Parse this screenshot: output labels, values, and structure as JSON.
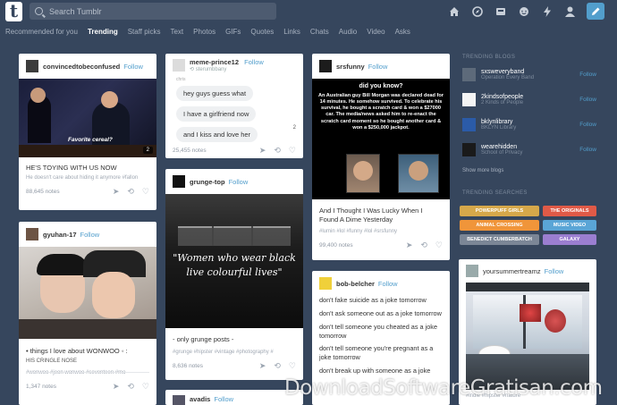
{
  "header": {
    "logo": "t",
    "search_placeholder": "Search Tumblr",
    "compose_icon": "pencil-icon",
    "icons": [
      "home-icon",
      "explore-icon",
      "inbox-icon",
      "messages-icon",
      "activity-icon",
      "account-icon"
    ]
  },
  "nav": {
    "items": [
      "Recommended for you",
      "Trending",
      "Staff picks",
      "Text",
      "Photos",
      "GIFs",
      "Quotes",
      "Links",
      "Chats",
      "Audio",
      "Video",
      "Asks"
    ],
    "active": "Trending"
  },
  "col1": {
    "post1": {
      "user": "convincedtobeconfused",
      "follow": "Follow",
      "gif_caption": "Favorite cereal?",
      "badge": "2",
      "caption": "HE'S TOYING WITH US NOW",
      "sub": "He doesn't care about hiding it anymore",
      "sub_tag": "#fallon",
      "notes": "88,645 notes"
    },
    "post2": {
      "user": "gyuhan-17",
      "follow": "Follow",
      "caption": "• things I love about WONWOO ◦ :",
      "sub": "HIS CRINGLE NOSE",
      "tags": "#wonwoo  #jeon wonwoo  #seventeen  #mo",
      "notes": "1,347 notes",
      "badge": "2"
    }
  },
  "col2": {
    "post1": {
      "user": "meme-prince12",
      "follow": "Follow",
      "via": "sterumbbany",
      "chat_label": "chris",
      "chat": [
        "hey guys guess what",
        "I have a girlfriend now",
        "and I kiss and love her"
      ],
      "badge": "2",
      "notes": "25,455 notes"
    },
    "post2": {
      "user": "grunge-top",
      "follow": "Follow",
      "quote_line1": "\"Women who wear black",
      "quote_line2": "live colourful lives\"",
      "caption": "- only grunge posts -",
      "tags": "#grunge  #hipster  #vintage  #photography  #",
      "notes": "8,636 notes"
    },
    "post3": {
      "user": "avadis",
      "follow": "Follow"
    }
  },
  "col3": {
    "post1": {
      "user": "srsfunny",
      "follow": "Follow",
      "meme_title": "did you know?",
      "meme_text": "An Australian guy Bill Morgan was declared dead for 14 minutes. He somehow survived. To celebrate his survival, he bought a scratch card & won a $27000 car. The media/news asked him to re-enact the scratch card moment so he bought another card & won a $250,000 jackpot.",
      "caption": "And I Thought I Was Lucky When I Found A Dime Yesterday",
      "tags": "#lumin  #lol  #funny  #lol  #srsfunny",
      "notes": "99,400 notes"
    },
    "post2": {
      "user": "bob-belcher",
      "follow": "Follow",
      "lines": [
        "don't fake suicide as a joke tomorrow",
        "don't ask someone out as a joke tomorrow",
        "don't tell someone you cheated as a joke tomorrow",
        "don't tell someone you're pregnant as a joke tomorrow",
        "don't break up with someone as a joke"
      ]
    }
  },
  "sidebar": {
    "blogs_title": "TRENDING BLOGS",
    "blogs": [
      {
        "name": "sxsweveryband",
        "sub": "Operation Every Band",
        "follow": "Follow",
        "color": "#5d6a7a"
      },
      {
        "name": "2kindsofpeople",
        "sub": "2 Kinds of People",
        "follow": "Follow",
        "color": "#f4f4f4"
      },
      {
        "name": "bklynlibrary",
        "sub": "BKLYN Library",
        "follow": "Follow",
        "color": "#2b5ba8"
      },
      {
        "name": "wearehidden",
        "sub": "School of Privacy",
        "follow": "Follow",
        "color": "#1a1a1a"
      }
    ],
    "more": "Show more blogs",
    "searches_title": "TRENDING SEARCHES",
    "searches": [
      {
        "label": "POWERPUFF GIRLS",
        "color": "#d6a84a"
      },
      {
        "label": "THE ORIGINALS",
        "color": "#e05a47"
      },
      {
        "label": "ANIMAL CROSSING",
        "color": "#f0953a"
      },
      {
        "label": "MUSIC VIDEO",
        "color": "#5aa5d6"
      },
      {
        "label": "BENEDICT CUMBERBATCH",
        "color": "#7b8696"
      },
      {
        "label": "GALAXY",
        "color": "#9b7ed0"
      }
    ],
    "radar": {
      "user": "yoursummertreamz",
      "follow": "Follow",
      "tags": "#indie  #hipster  #nature"
    }
  },
  "watermark": "DownloadSoftwareGratisan.com"
}
